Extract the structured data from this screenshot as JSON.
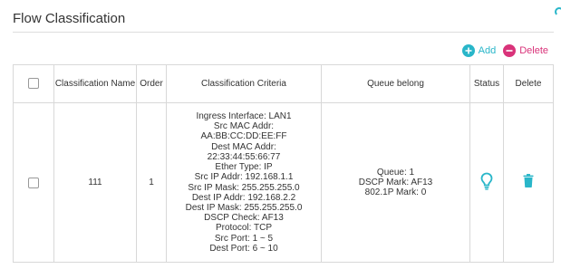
{
  "section": {
    "title": "Flow Classification"
  },
  "toolbar": {
    "add_label": "Add",
    "delete_label": "Delete"
  },
  "table": {
    "headers": {
      "select": "",
      "classification_name": "Classification Name",
      "order": "Order",
      "criteria": "Classification Criteria",
      "queue": "Queue belong",
      "status": "Status",
      "delete": "Delete"
    },
    "rows": [
      {
        "name": "111",
        "order": "1",
        "criteria": [
          "Ingress Interface: LAN1",
          "Src MAC Addr:",
          "AA:BB:CC:DD:EE:FF",
          "Dest MAC Addr:",
          "22:33:44:55:66:77",
          "Ether Type: IP",
          "Src IP Addr: 192.168.1.1",
          "Src IP Mask: 255.255.255.0",
          "Dest IP Addr: 192.168.2.2",
          "Dest IP Mask: 255.255.255.0",
          "DSCP Check: AF13",
          "Protocol: TCP",
          "Src Port: 1 ~ 5",
          "Dest Port: 6 ~ 10"
        ],
        "queue": [
          "Queue: 1",
          "DSCP Mark: AF13",
          "802.1P Mark: 0"
        ],
        "status_icon": "lightbulb-icon",
        "delete_icon": "trash-icon"
      }
    ]
  },
  "colors": {
    "accent": "#29b6c9",
    "danger": "#d9337a"
  }
}
